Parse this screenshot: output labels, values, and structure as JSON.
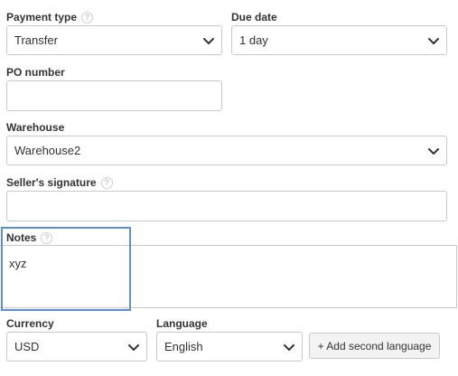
{
  "payment_type": {
    "label": "Payment type",
    "help": "?",
    "value": "Transfer"
  },
  "due_date": {
    "label": "Due date",
    "value": "1 day"
  },
  "po_number": {
    "label": "PO number",
    "value": ""
  },
  "warehouse": {
    "label": "Warehouse",
    "value": "Warehouse2"
  },
  "sellers_signature": {
    "label": "Seller's signature",
    "help": "?",
    "value": ""
  },
  "notes": {
    "label": "Notes",
    "help": "?",
    "value": "xyz"
  },
  "currency": {
    "label": "Currency",
    "value": "USD"
  },
  "language": {
    "label": "Language",
    "value": "English"
  },
  "add_second_language": {
    "label": "+ Add second language"
  },
  "colors": {
    "focus_highlight": "#5b8fd9",
    "border": "#c8c8c8",
    "button_bg": "#f3f3f3",
    "text": "#333333"
  }
}
